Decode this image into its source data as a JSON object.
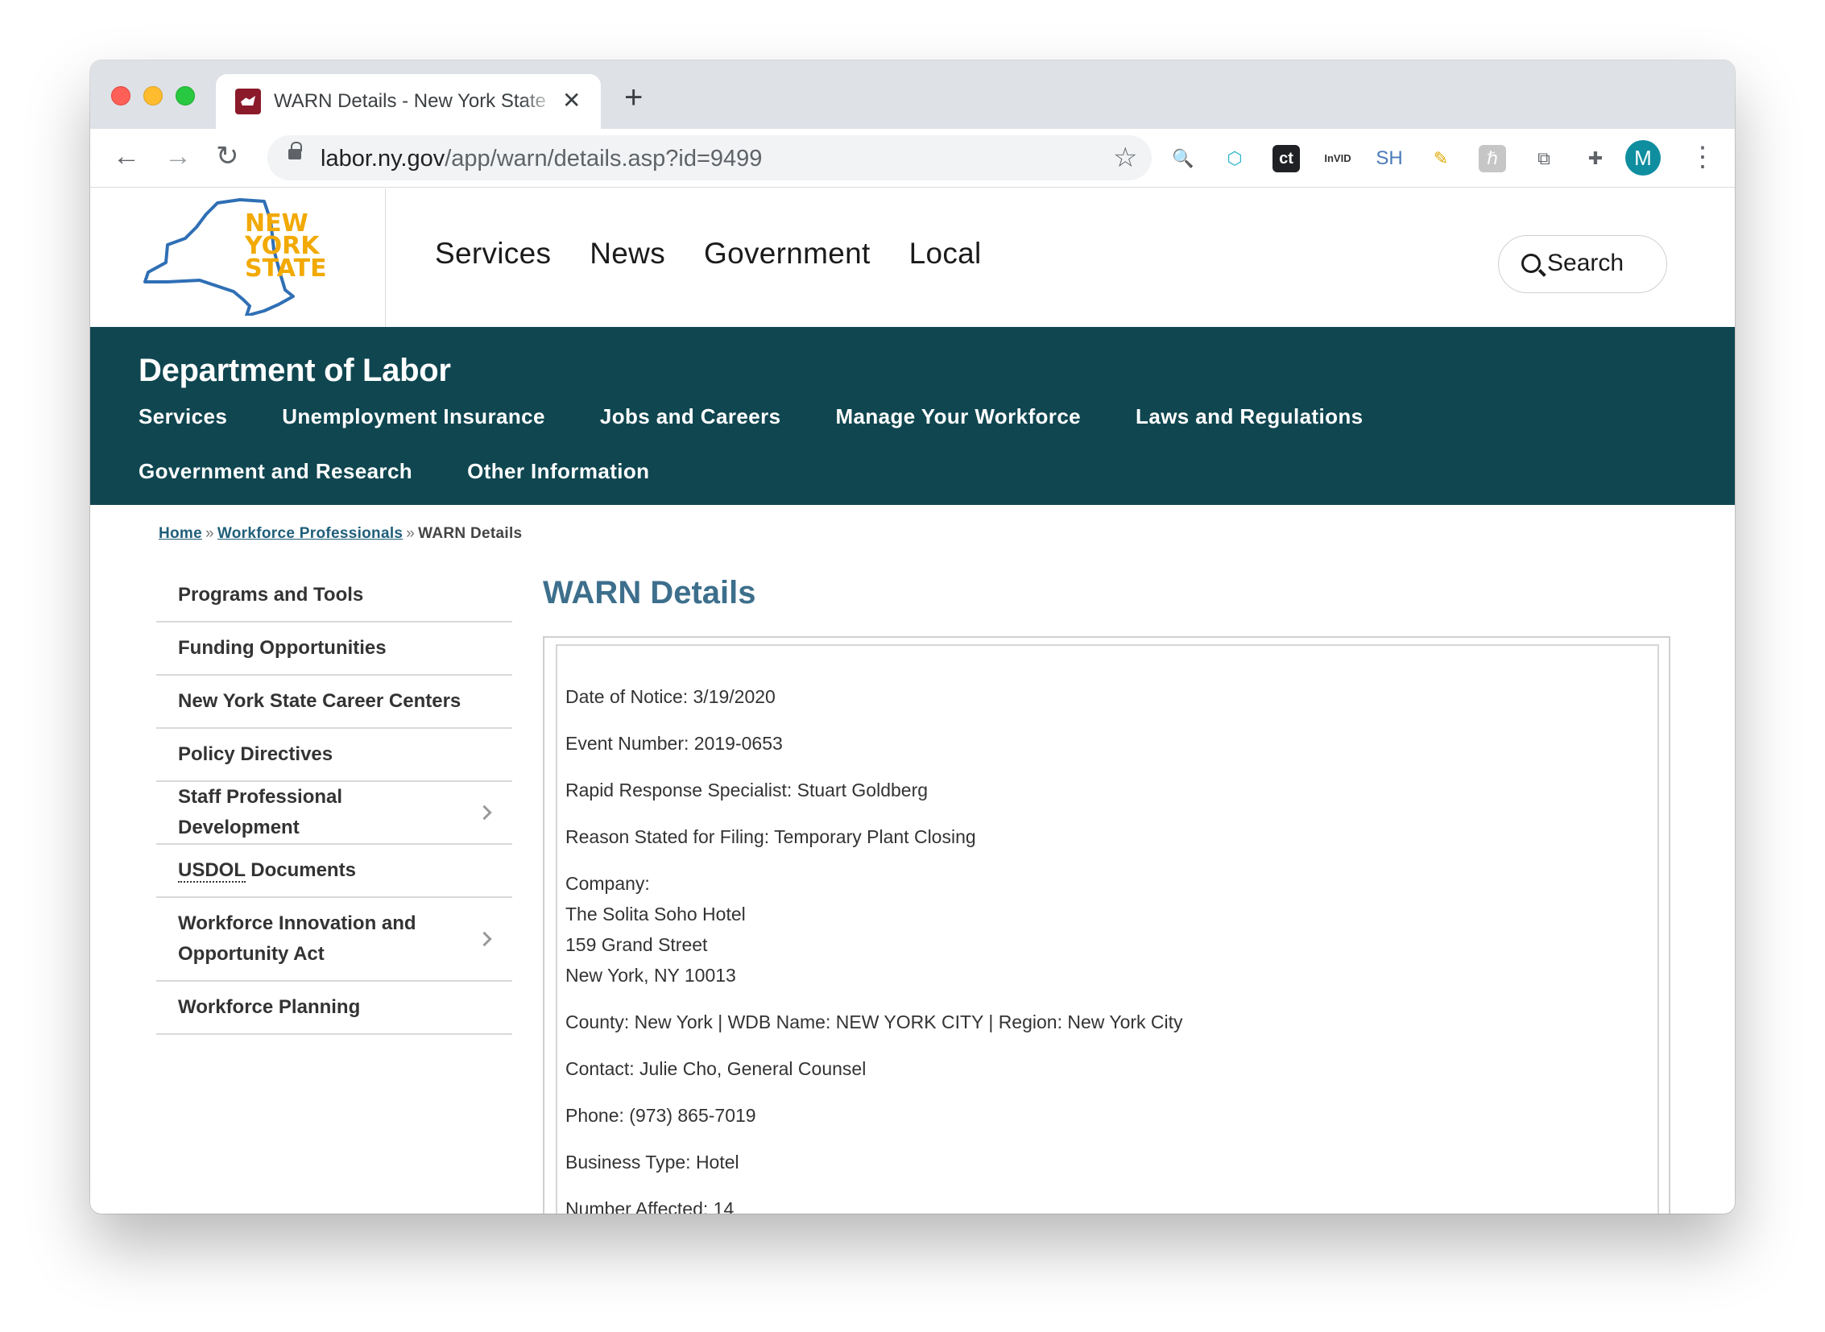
{
  "browser": {
    "tab_title": "WARN Details - New York State",
    "tab_close": "✕",
    "new_tab": "+",
    "url_host": "labor.ny.gov",
    "url_path": "/app/warn/details.asp?id=9499",
    "extensions": [
      "search-ext",
      "shield-ext",
      "ct",
      "InVID",
      "SH",
      "highlighter-ext",
      "grey-ext",
      "copy-ext",
      "puzzle-ext"
    ],
    "ext_labels": {
      "ct": "ct",
      "invid": "InVID",
      "sh": "SH"
    },
    "profile_initial": "M"
  },
  "nys_header": {
    "logo_lines": [
      "NEW",
      "YORK",
      "STATE"
    ],
    "nav": [
      "Services",
      "News",
      "Government",
      "Local"
    ],
    "search_label": "Search"
  },
  "dol": {
    "title": "Department of Labor",
    "nav_row1": [
      "Services",
      "Unemployment Insurance",
      "Jobs and Careers",
      "Manage Your Workforce",
      "Laws and Regulations"
    ],
    "nav_row2": [
      "Government and Research",
      "Other Information"
    ]
  },
  "breadcrumb": {
    "home": "Home",
    "section": "Workforce Professionals",
    "current": "WARN Details",
    "separator": "»"
  },
  "sidenav": {
    "items": [
      {
        "label": "Programs and Tools",
        "chevron": false
      },
      {
        "label": "Funding Opportunities",
        "chevron": false
      },
      {
        "label": "New York State Career Centers",
        "chevron": false
      },
      {
        "label": "Policy Directives",
        "chevron": false
      },
      {
        "label": "Staff Professional Development",
        "chevron": true
      },
      {
        "label_abbr": "USDOL",
        "label_rest": " Documents",
        "chevron": false
      },
      {
        "label_line1": "Workforce Innovation and",
        "label_line2": "Opportunity Act",
        "chevron": true
      },
      {
        "label": "Workforce Planning",
        "chevron": false
      }
    ]
  },
  "content": {
    "title": "WARN Details",
    "date_of_notice": "Date of Notice: 3/19/2020",
    "event_number": "Event Number: 2019-0653",
    "specialist": "Rapid Response Specialist: Stuart Goldberg",
    "reason": "Reason Stated for Filing: Temporary Plant Closing",
    "company_label": "Company:",
    "company_name": "The Solita Soho Hotel",
    "company_street": "159 Grand Street",
    "company_city": "New York, NY 10013",
    "region_line": "County: New York | WDB Name: NEW YORK CITY | Region: New York City",
    "contact": "Contact: Julie Cho, General Counsel",
    "phone": "Phone: (973) 865-7019",
    "business_type": "Business Type: Hotel",
    "number_affected": "Number Affected: 14"
  },
  "colors": {
    "dol_bar": "#0f4650",
    "title_blue": "#3d6f8c",
    "logo_orange": "#f2a900",
    "logo_outline": "#2f6fb5"
  }
}
